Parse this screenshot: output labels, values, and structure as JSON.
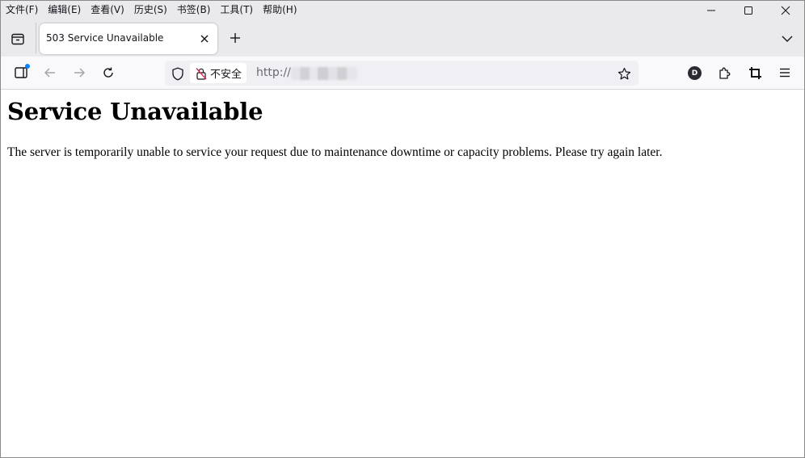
{
  "menu": {
    "items": [
      "文件(F)",
      "编辑(E)",
      "查看(V)",
      "历史(S)",
      "书签(B)",
      "工具(T)",
      "帮助(H)"
    ]
  },
  "window_controls": [
    "minimize-icon",
    "maximize-icon",
    "close-icon"
  ],
  "tabs": [
    {
      "title": "503 Service Unavailable",
      "active": true
    }
  ],
  "navbar": {
    "security_label": "不安全",
    "url": "http://",
    "url_rest_obscured": true,
    "account_initial": "D"
  },
  "page": {
    "heading": "Service Unavailable",
    "message": "The server is temporarily unable to service your request due to maintenance downtime or capacity problems. Please try again later."
  },
  "colors": {
    "chrome_bg": "#eaeaed",
    "toolbar_bg": "#f9f9fb",
    "urlbar_bg": "#f0f0f4",
    "accent_dot": "#0a84ff",
    "icon": "#15141a"
  }
}
